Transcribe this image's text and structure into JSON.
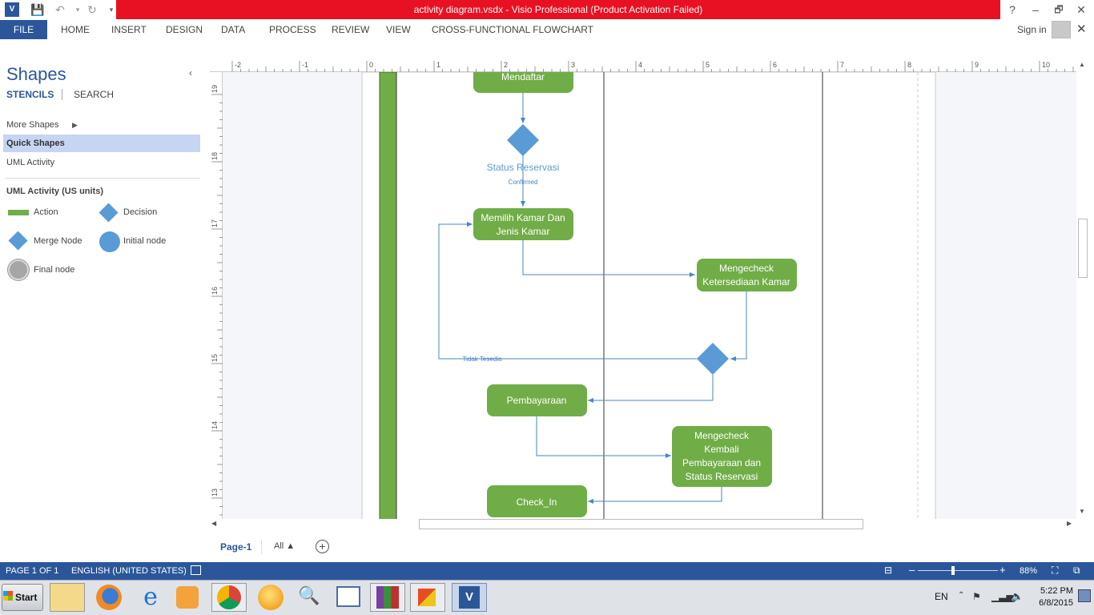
{
  "window": {
    "title": "activity diagram.vsdx - Visio Professional (Product Activation Failed)",
    "help": "?",
    "minimize": "–",
    "restore": "🗗",
    "close": "✕"
  },
  "ribbon": {
    "tabs": [
      "FILE",
      "HOME",
      "INSERT",
      "DESIGN",
      "DATA",
      "PROCESS",
      "REVIEW",
      "VIEW",
      "CROSS-FUNCTIONAL FLOWCHART"
    ],
    "sign_in": "Sign in"
  },
  "shapes_panel": {
    "title": "Shapes",
    "collapse": "‹",
    "tab_stencils": "STENCILS",
    "tab_search": "SEARCH",
    "items": [
      "More Shapes",
      "Quick Shapes",
      "UML Activity"
    ],
    "stencil_name": "UML Activity (US units)",
    "stencil_shapes": [
      "Action",
      "Decision",
      "Merge Node",
      "Initial node",
      "Final node"
    ],
    "colors": {
      "action": "#70ad47",
      "decision": "#5b9bd5",
      "final": "#a6a6a6"
    }
  },
  "ruler": {
    "h_ticks": [
      "-2",
      "-1",
      "0",
      "1",
      "2",
      "3",
      "4",
      "5",
      "6",
      "7",
      "8",
      "9",
      "10"
    ],
    "v_ticks": [
      "19",
      "18",
      "17",
      "16",
      "15",
      "14",
      "13"
    ]
  },
  "diagram": {
    "nodes": {
      "mendaftar": "Mendaftar",
      "memilih_l1": "Memilih Kamar Dan",
      "memilih_l2": "Jenis Kamar",
      "cek_l1": "Mengecheck",
      "cek_l2": "Ketersediaan Kamar",
      "bayar": "Pembayaraan",
      "cek2_l1": "Mengecheck",
      "cek2_l2": "Kembali",
      "cek2_l3": "Pembayaraan dan",
      "cek2_l4": "Status Reservasi",
      "checkin": "Check_In"
    },
    "labels": {
      "status": "Status Reservasi",
      "confirmed": "Confirmed",
      "tidak": "Tidak Tesedia"
    },
    "colors": {
      "action": "#70ad47",
      "decision": "#5b9bd5",
      "connector": "#4a86c5"
    }
  },
  "page_tabs": {
    "page": "Page-1",
    "all": "All ▲",
    "add": "+"
  },
  "status_bar": {
    "page": "PAGE 1 OF 1",
    "language": "ENGLISH (UNITED STATES)",
    "zoom": "88%"
  },
  "taskbar": {
    "start": "Start",
    "lang": "EN",
    "time": "5:22 PM",
    "date": "6/8/2015"
  }
}
